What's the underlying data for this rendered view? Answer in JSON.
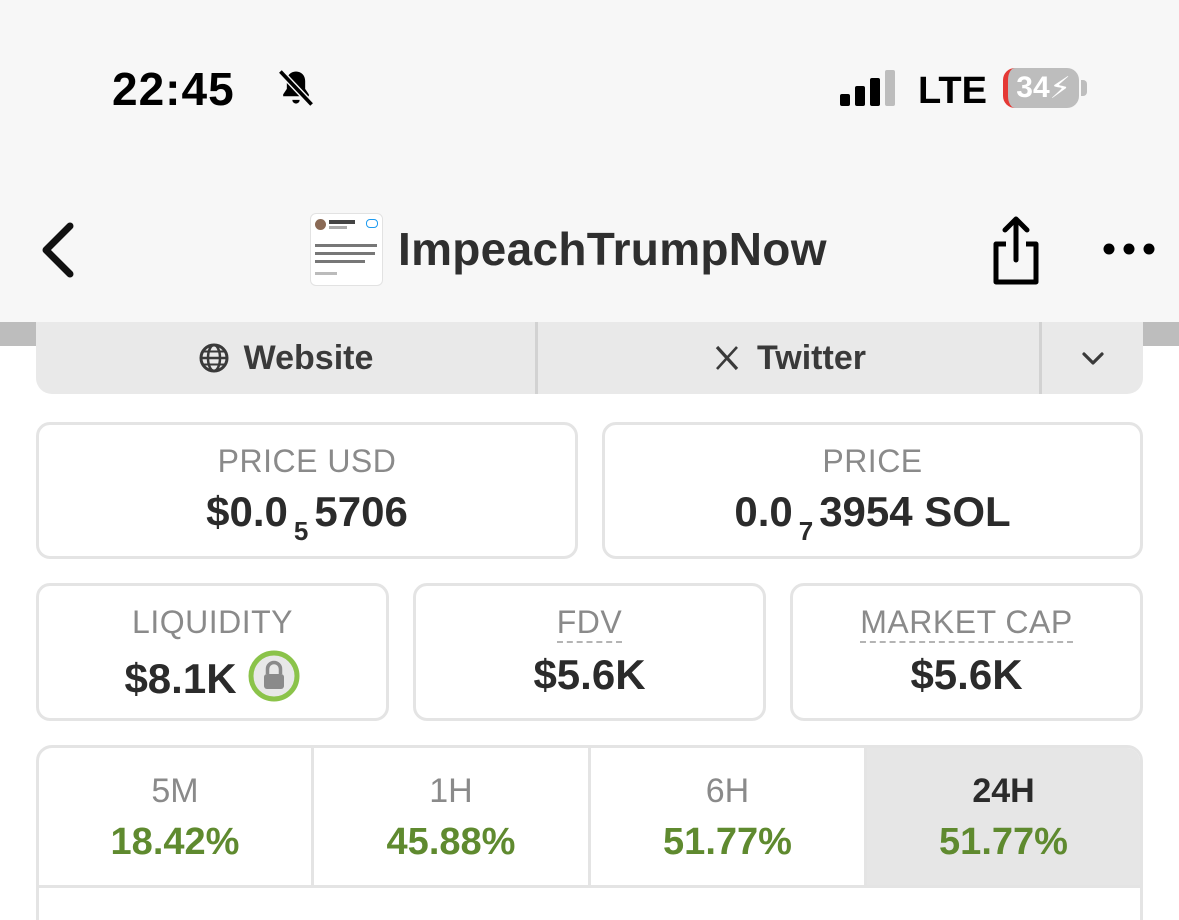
{
  "status_bar": {
    "time": "22:45",
    "network": "LTE",
    "battery": "34"
  },
  "header": {
    "title": "ImpeachTrumpNow"
  },
  "links": {
    "website_label": "Website",
    "twitter_label": "Twitter"
  },
  "prices": {
    "price_usd_label": "PRICE USD",
    "price_usd_prefix": "$0.0",
    "price_usd_subscript": "5",
    "price_usd_suffix": "5706",
    "price_sol_label": "PRICE",
    "price_sol_prefix": "0.0",
    "price_sol_subscript": "7",
    "price_sol_suffix": "3954 SOL"
  },
  "metrics": {
    "liquidity_label": "LIQUIDITY",
    "liquidity_value": "$8.1K",
    "fdv_label": "FDV",
    "fdv_value": "$5.6K",
    "market_cap_label": "MARKET CAP",
    "market_cap_value": "$5.6K"
  },
  "timeframes": [
    {
      "label": "5M",
      "change": "18.42%"
    },
    {
      "label": "1H",
      "change": "45.88%"
    },
    {
      "label": "6H",
      "change": "51.77%"
    },
    {
      "label": "24H",
      "change": "51.77%"
    }
  ],
  "colors": {
    "positive": "#5f8a2f",
    "lock_ring": "#8bc34a",
    "battery_low": "#e53935"
  }
}
